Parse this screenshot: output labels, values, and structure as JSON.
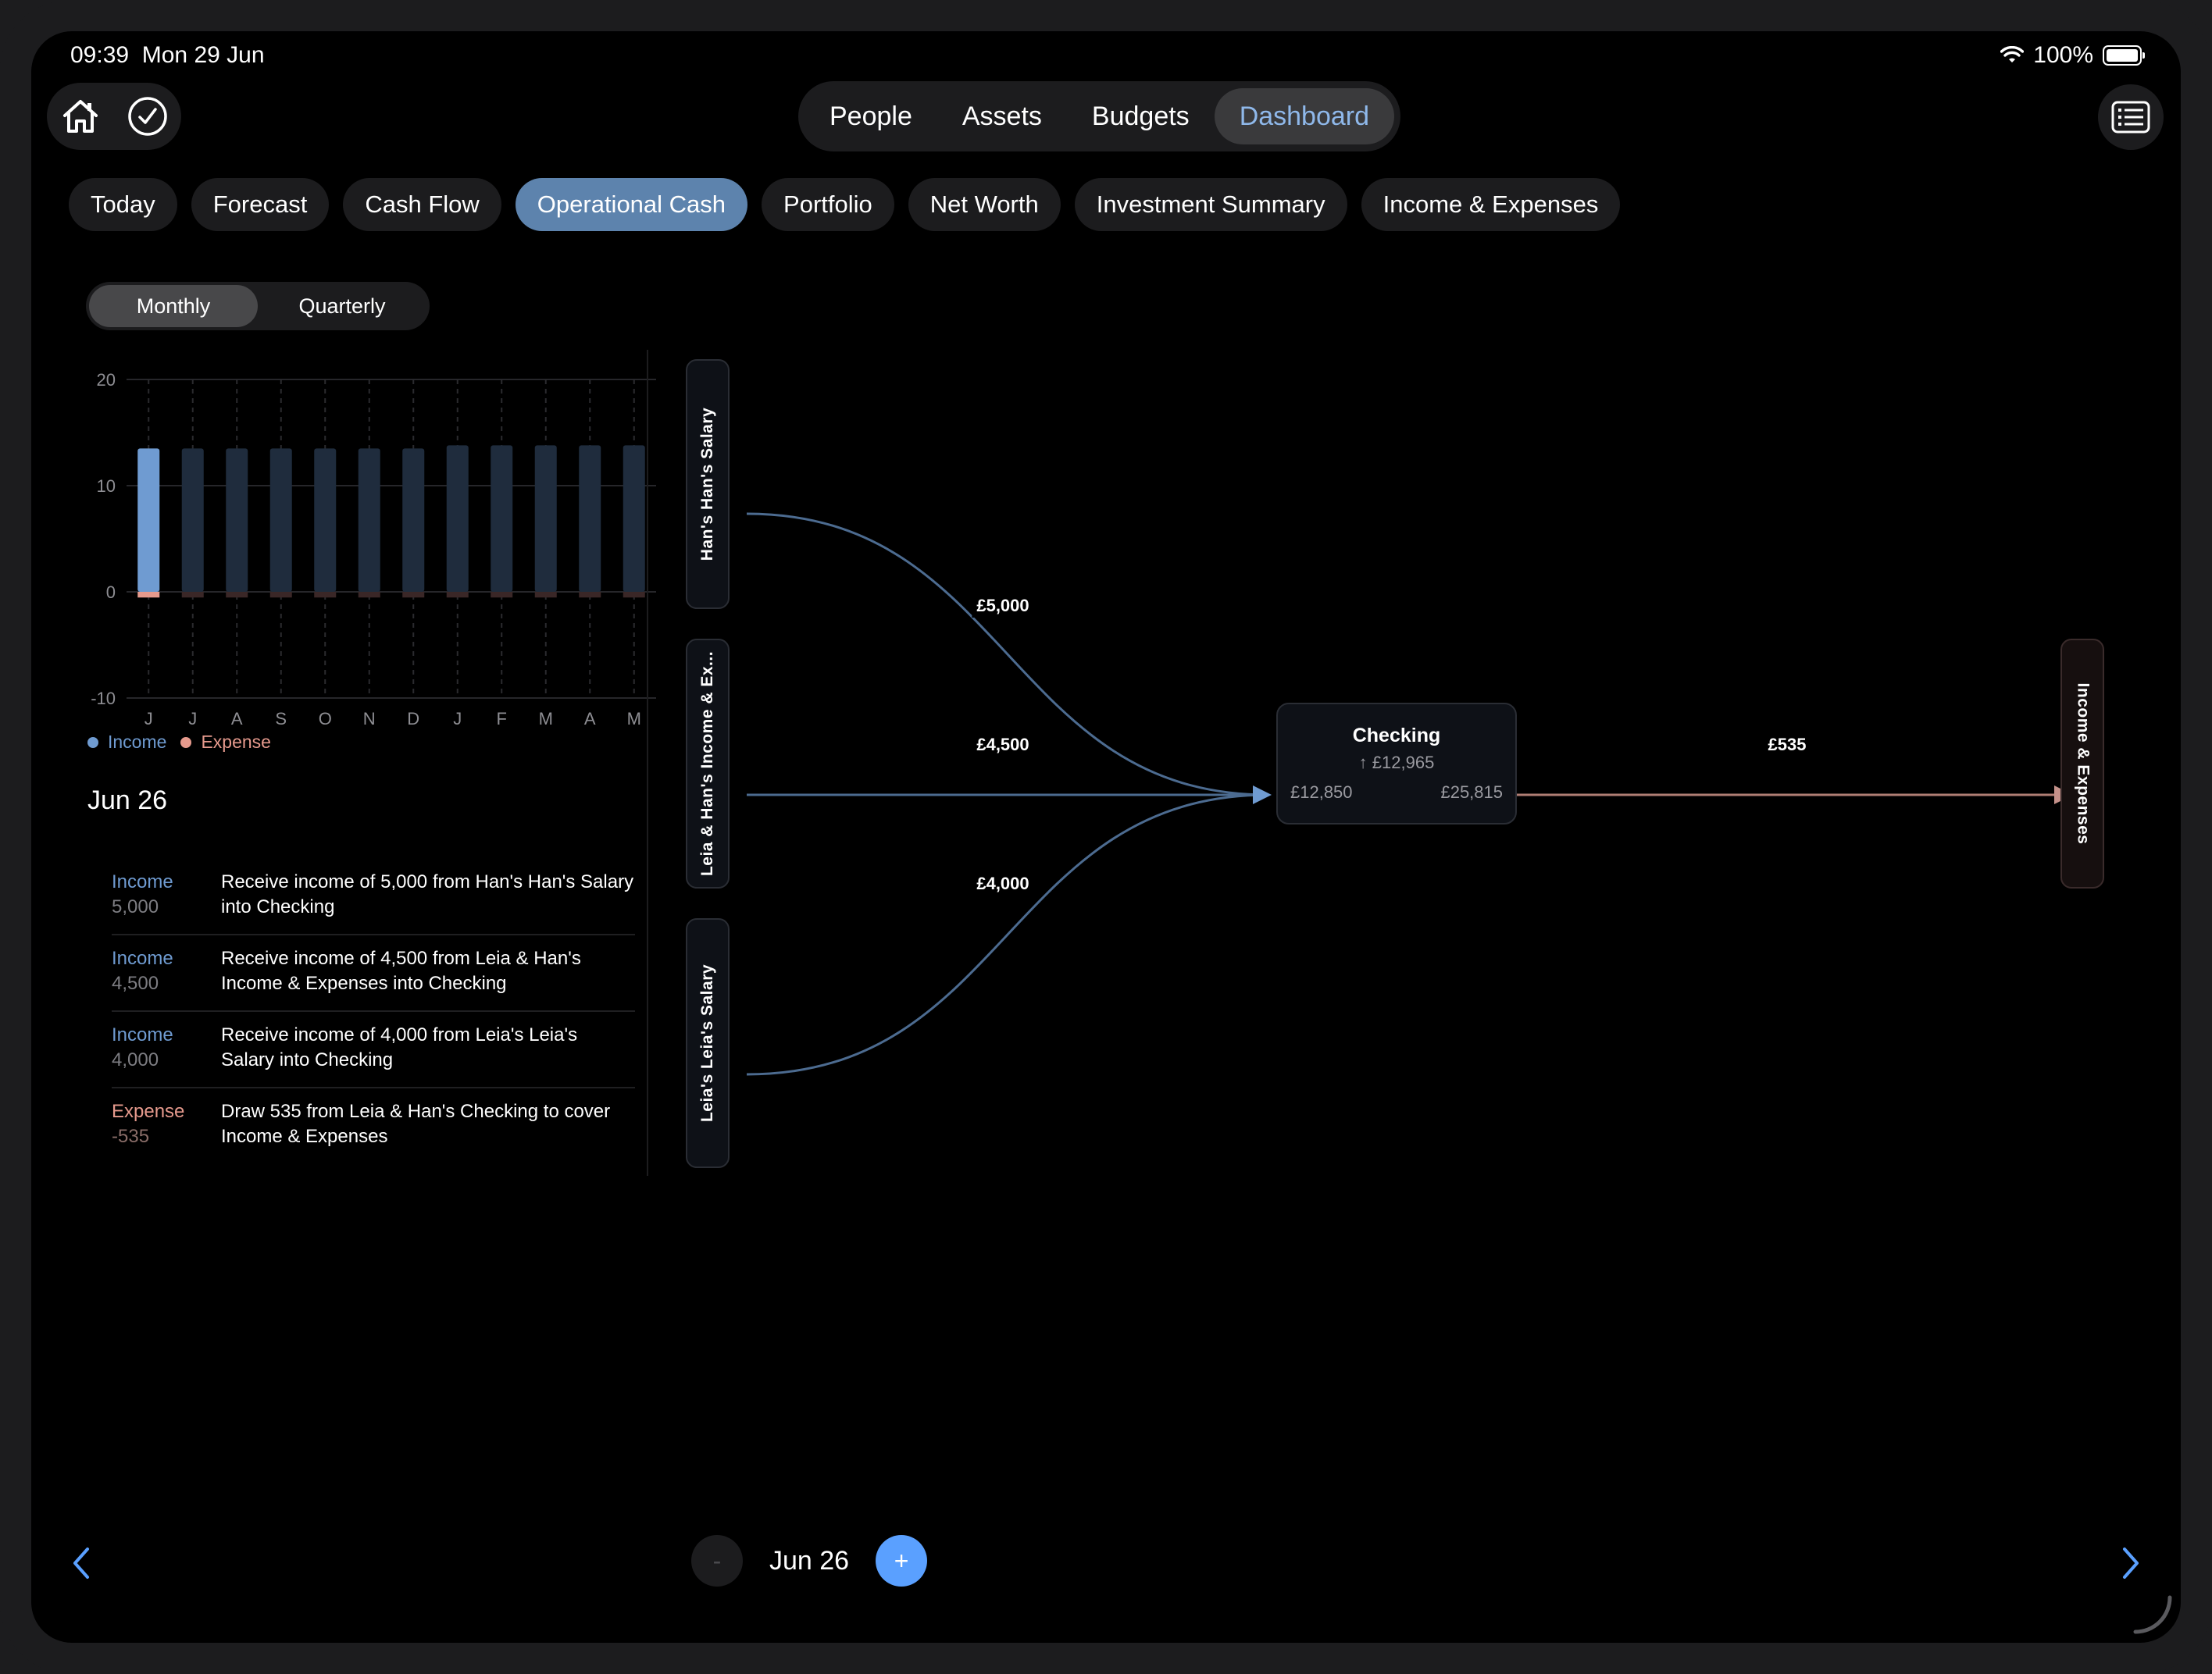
{
  "status": {
    "time": "09:39",
    "date": "Mon 29 Jun",
    "battery": "100%"
  },
  "top_nav": {
    "items": [
      {
        "label": "People",
        "active": false
      },
      {
        "label": "Assets",
        "active": false
      },
      {
        "label": "Budgets",
        "active": false
      },
      {
        "label": "Dashboard",
        "active": true
      }
    ]
  },
  "icons": {
    "home": "home-icon",
    "check": "checkmark-circle-icon",
    "notes": "list-icon"
  },
  "tabs": [
    {
      "label": "Today",
      "active": false
    },
    {
      "label": "Forecast",
      "active": false
    },
    {
      "label": "Cash Flow",
      "active": false
    },
    {
      "label": "Operational Cash",
      "active": true
    },
    {
      "label": "Portfolio",
      "active": false
    },
    {
      "label": "Net Worth",
      "active": false
    },
    {
      "label": "Investment Summary",
      "active": false
    },
    {
      "label": "Income & Expenses",
      "active": false
    }
  ],
  "period": {
    "options": [
      "Monthly",
      "Quarterly"
    ],
    "selected": "Monthly"
  },
  "chart_data": {
    "type": "bar",
    "categories": [
      "J",
      "J",
      "A",
      "S",
      "O",
      "N",
      "D",
      "J",
      "F",
      "M",
      "A",
      "M"
    ],
    "series": [
      {
        "name": "Income",
        "values": [
          13.5,
          13.5,
          13.5,
          13.5,
          13.5,
          13.5,
          13.5,
          13.8,
          13.8,
          13.8,
          13.8,
          13.8
        ]
      },
      {
        "name": "Expense",
        "values": [
          -0.535,
          -0.535,
          -0.535,
          -0.535,
          -0.535,
          -0.535,
          -0.535,
          -0.535,
          -0.535,
          -0.535,
          -0.535,
          -0.535
        ]
      }
    ],
    "yticks": [
      20,
      10,
      0,
      -10
    ],
    "ylim": [
      -10,
      20
    ],
    "highlight_index": 0,
    "colors": {
      "income": "#6f9bd1",
      "income_dim": "#1f2c3d",
      "expense": "#e69a8d",
      "expense_dim": "#3a2727"
    },
    "grid": true
  },
  "legend": {
    "income": "Income",
    "expense": "Expense"
  },
  "detail": {
    "date": "Jun 26",
    "transactions": [
      {
        "kind": "Income",
        "amount": "5,000",
        "type": "income",
        "description": "Receive income of 5,000 from Han's Han's Salary into Checking"
      },
      {
        "kind": "Income",
        "amount": "4,500",
        "type": "income",
        "description": "Receive income of 4,500 from Leia & Han's Income & Expenses into Checking"
      },
      {
        "kind": "Income",
        "amount": "4,000",
        "type": "income",
        "description": "Receive income of 4,000 from Leia's Leia's Salary into Checking"
      },
      {
        "kind": "Expense",
        "amount": "-535",
        "type": "expense",
        "description": "Draw 535 from Leia & Han's Checking to cover Income & Expenses"
      }
    ]
  },
  "flow": {
    "sources": [
      {
        "label": "Han's Han's Salary",
        "flow": "£5,000"
      },
      {
        "label": "Leia & Han's Income & Ex...",
        "flow": "£4,500"
      },
      {
        "label": "Leia's Leia's Salary",
        "flow": "£4,000"
      }
    ],
    "account": {
      "name": "Checking",
      "change": "↑ £12,965",
      "start": "£12,850",
      "end": "£25,815"
    },
    "destination": {
      "label": "Income & Expenses",
      "flow": "£535"
    },
    "colors": {
      "inflow": "#4c6b90",
      "outflow": "#b07e74"
    }
  },
  "stepper": {
    "label": "Jun 26",
    "minus": "-",
    "plus": "+"
  }
}
